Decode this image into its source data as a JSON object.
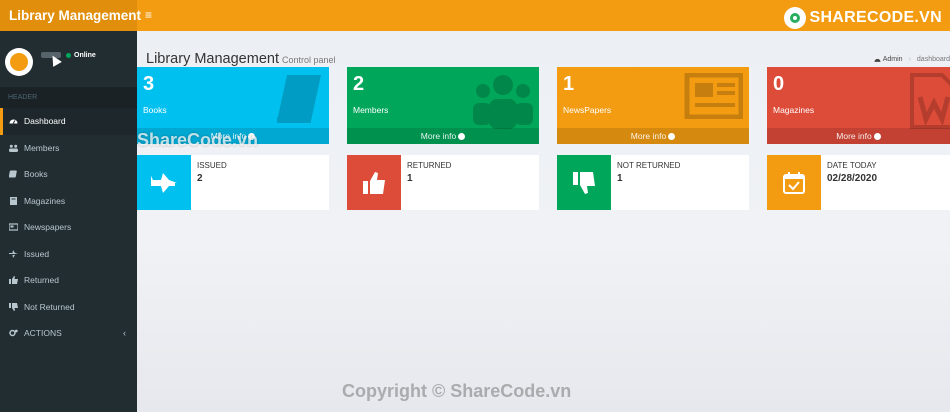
{
  "header": {
    "brand": "Library Management",
    "toggle": "≡",
    "watermark_logo": "SHARECODE.VN"
  },
  "sidebar": {
    "user": {
      "status": "Online"
    },
    "section": "HEADER",
    "items": [
      {
        "label": "Dashboard",
        "icon": "dashboard-icon"
      },
      {
        "label": "Members",
        "icon": "users-icon"
      },
      {
        "label": "Books",
        "icon": "book-icon"
      },
      {
        "label": "Magazines",
        "icon": "magazine-icon"
      },
      {
        "label": "Newspapers",
        "icon": "newspaper-icon"
      },
      {
        "label": "Issued",
        "icon": "plane-icon"
      },
      {
        "label": "Returned",
        "icon": "thumbs-up-icon"
      },
      {
        "label": "Not Returned",
        "icon": "thumbs-down-icon"
      },
      {
        "label": "ACTIONS",
        "icon": "cogs-icon"
      }
    ]
  },
  "main": {
    "title": "Library Management",
    "subtitle": "Control panel",
    "breadcrumb": [
      "Admin",
      "dashboard"
    ],
    "boxes": [
      {
        "value": "3",
        "label": "Books",
        "footer": "More info",
        "color": "#00c0ef",
        "icon": "book-icon"
      },
      {
        "value": "2",
        "label": "Members",
        "footer": "More info",
        "color": "#00a65a",
        "icon": "users-icon"
      },
      {
        "value": "1",
        "label": "NewsPapers",
        "footer": "More info",
        "color": "#f39c12",
        "icon": "newspaper-icon"
      },
      {
        "value": "0",
        "label": "Magazines",
        "footer": "More info",
        "color": "#dd4b39",
        "icon": "word-file-icon"
      }
    ],
    "info": [
      {
        "label": "ISSUED",
        "value": "2",
        "color": "#00c0ef",
        "icon": "plane-icon"
      },
      {
        "label": "RETURNED",
        "value": "1",
        "color": "#dd4b39",
        "icon": "thumbs-up-icon"
      },
      {
        "label": "NOT RETURNED",
        "value": "1",
        "color": "#00a65a",
        "icon": "thumbs-down-icon"
      },
      {
        "label": "DATE TODAY",
        "value": "02/28/2020",
        "color": "#f39c12",
        "icon": "calendar-icon"
      }
    ]
  },
  "watermarks": {
    "center": "ShareCode.vn",
    "bottom": "Copyright © ShareCode.vn"
  }
}
